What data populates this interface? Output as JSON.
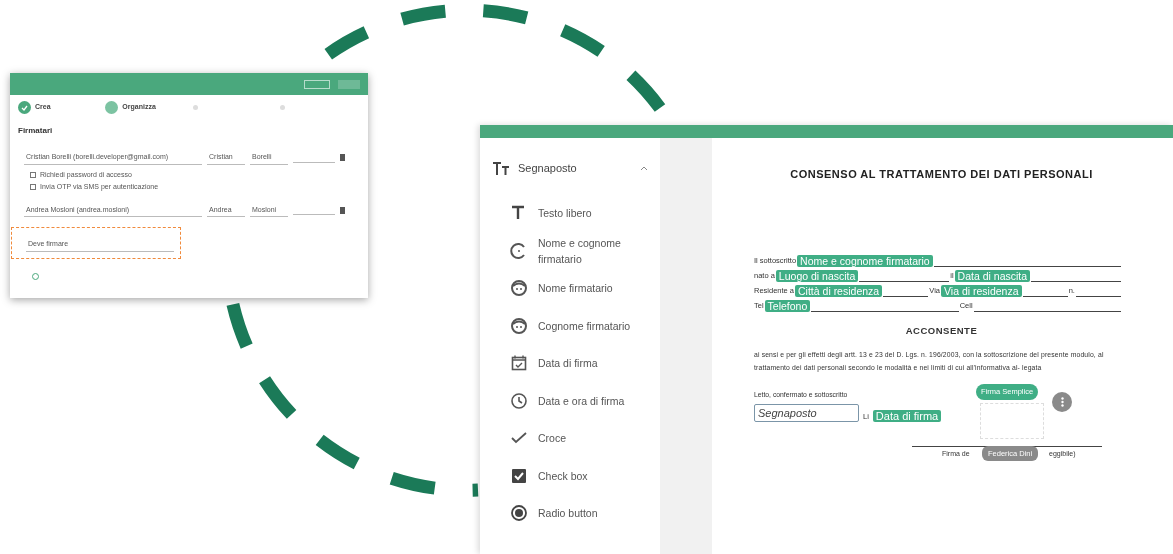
{
  "left_window": {
    "steps": [
      {
        "label": "Crea",
        "completed": true,
        "selected": false
      },
      {
        "label": "Organizza",
        "completed": false,
        "selected": true
      },
      {
        "completed": false,
        "selected": false
      },
      {
        "completed": false,
        "selected": false
      }
    ],
    "section_title": "Firmatari",
    "signers": [
      {
        "contact": "Cristian Borelli (borelli.developer@gmail.com)",
        "first_name": "Cristian",
        "last_name": "Borelli",
        "options": [
          {
            "label": "Richiedi password di accesso",
            "checked": false
          },
          {
            "label": "Invia OTP via SMS per autenticazione",
            "checked": false
          }
        ]
      },
      {
        "contact": "Andrea Mosloni (andrea.mosloni)",
        "first_name": "Andrea",
        "last_name": "Mosloni"
      }
    ],
    "action_field": {
      "value": "Deve firmare",
      "highlighted": true
    }
  },
  "right_window": {
    "sidebar": {
      "title": "Segnaposto",
      "expanded": true,
      "items": [
        {
          "label": "Testo libero"
        },
        {
          "label": "Nome e cognome firmatario"
        },
        {
          "label": "Nome firmatario"
        },
        {
          "label": "Cognome firmatario"
        },
        {
          "label": "Data di firma"
        },
        {
          "label": "Data e ora di firma"
        },
        {
          "label": "Croce"
        },
        {
          "label": "Check box"
        },
        {
          "label": "Radio button"
        }
      ]
    },
    "document": {
      "title": "CONSENSO AL TRATTAMENTO DEI DATI PERSONALI",
      "form_lines": [
        [
          {
            "kind": "text",
            "text": "Il sottoscritto"
          },
          {
            "kind": "tag",
            "text": "Nome e cognome firmatario"
          },
          {
            "kind": "blank"
          }
        ],
        [
          {
            "kind": "text",
            "text": "nato a"
          },
          {
            "kind": "tag",
            "text": "Luogo di nascita"
          },
          {
            "kind": "blank"
          },
          {
            "kind": "text",
            "text": "il"
          },
          {
            "kind": "tag",
            "text": "Data di nascita"
          },
          {
            "kind": "blank"
          }
        ],
        [
          {
            "kind": "text",
            "text": "Residente a"
          },
          {
            "kind": "tag",
            "text": "Città di residenza"
          },
          {
            "kind": "blank"
          },
          {
            "kind": "text",
            "text": "Via"
          },
          {
            "kind": "tag",
            "text": "Via di residenza"
          },
          {
            "kind": "blank"
          },
          {
            "kind": "text",
            "text": "n."
          },
          {
            "kind": "blank"
          }
        ],
        [
          {
            "kind": "text",
            "text": "Tel"
          },
          {
            "kind": "tag",
            "text": "Telefono"
          },
          {
            "kind": "blank"
          },
          {
            "kind": "text",
            "text": "Cell"
          },
          {
            "kind": "blank"
          }
        ]
      ],
      "heading": "ACCONSENTE",
      "paragraph": "ai sensi e per gli effetti degli artt. 13 e 23 del D. Lgs. n. 196/2003, con la sottoscrizione del presente modulo, al trattamento dei dati personali secondo le modalità e nei limiti di cui all'informativa al- legata",
      "signoff": "Letto, confermato e sottoscritto",
      "placeholder_field": "Segnaposto",
      "place_label": "Li",
      "date_tag": "Data di firma",
      "signature": {
        "badge": "Firma Semplice",
        "label_start": "Firma de",
        "label_end": "eggibile)",
        "signer_tooltip": "Federica Dini"
      }
    }
  }
}
